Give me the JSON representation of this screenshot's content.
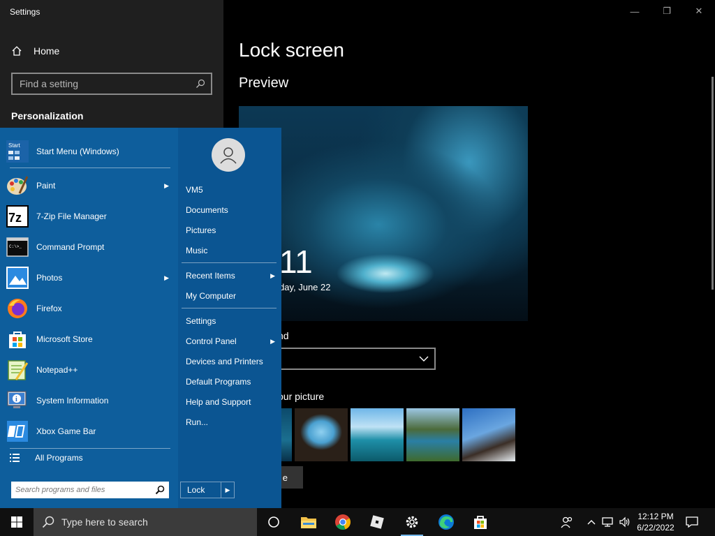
{
  "window": {
    "title": "Settings",
    "controls": {
      "minimize": "—",
      "maximize": "❐",
      "close": "✕"
    }
  },
  "sidebar": {
    "home_label": "Home",
    "search_placeholder": "Find a setting",
    "section_label": "Personalization"
  },
  "main": {
    "page_title": "Lock screen",
    "preview_heading": "Preview",
    "preview_time": "11",
    "preview_date": "day, June 22",
    "background_label": "nd",
    "choose_picture_label": "our picture",
    "browse_button_label": "e"
  },
  "start_menu": {
    "header_item": "Start Menu (Windows)",
    "programs": [
      {
        "label": "Paint",
        "has_submenu": true,
        "icon": "paint-icon"
      },
      {
        "label": "7-Zip File Manager",
        "has_submenu": false,
        "icon": "7zip-icon"
      },
      {
        "label": "Command Prompt",
        "has_submenu": false,
        "icon": "cmd-icon"
      },
      {
        "label": "Photos",
        "has_submenu": true,
        "icon": "photos-icon"
      },
      {
        "label": "Firefox",
        "has_submenu": false,
        "icon": "firefox-icon"
      },
      {
        "label": "Microsoft Store",
        "has_submenu": false,
        "icon": "store-icon"
      },
      {
        "label": "Notepad++",
        "has_submenu": false,
        "icon": "notepadpp-icon"
      },
      {
        "label": "System Information",
        "has_submenu": false,
        "icon": "sysinfo-icon"
      },
      {
        "label": "Xbox Game Bar",
        "has_submenu": false,
        "icon": "xbox-icon"
      }
    ],
    "all_programs": "All Programs",
    "search_placeholder": "Search programs and files",
    "right_links": {
      "user": "VM5",
      "documents": "Documents",
      "pictures": "Pictures",
      "music": "Music",
      "recent_items": "Recent Items",
      "my_computer": "My Computer",
      "settings": "Settings",
      "control_panel": "Control Panel",
      "devices_printers": "Devices and Printers",
      "default_programs": "Default Programs",
      "help_support": "Help and Support",
      "run": "Run..."
    },
    "lock_button": "Lock"
  },
  "taskbar": {
    "search_placeholder": "Type here to search",
    "pinned": [
      "task-view-icon",
      "file-explorer-icon",
      "chrome-icon",
      "roblox-icon",
      "settings-icon",
      "edge-icon",
      "store-icon"
    ],
    "time": "12:12 PM",
    "date": "6/22/2022"
  },
  "colors": {
    "start_menu_bg": "#0e5e9c",
    "settings_sidebar_bg": "#1f1f1f",
    "taskbar_bg": "#101010",
    "accent": "#76b9ed"
  }
}
